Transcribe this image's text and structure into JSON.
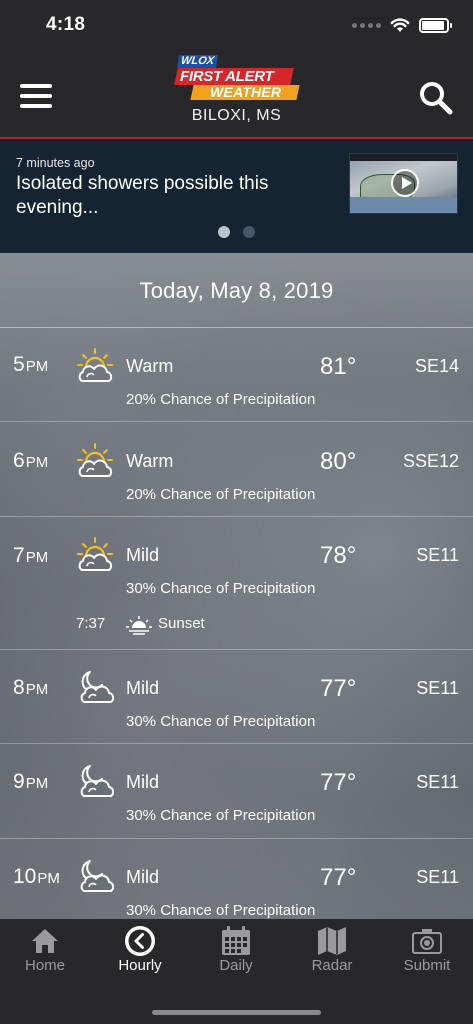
{
  "status_bar": {
    "time": "4:18"
  },
  "header": {
    "logo": {
      "station": "WLOX",
      "line1": "FIRST ALERT",
      "line2": "WEATHER"
    },
    "location": "BILOXI, MS"
  },
  "alert": {
    "timestamp": "7 minutes ago",
    "title": "Isolated showers possible this evening...",
    "pages": 2,
    "active_page": 1
  },
  "forecast": {
    "date": "Today, May 8, 2019",
    "hours": [
      {
        "hour": "5",
        "ampm": "PM",
        "icon": "partly-sunny-icon",
        "desc": "Warm",
        "temp": "81°",
        "wind": "SE14",
        "precip": "20% Chance of Precipitation"
      },
      {
        "hour": "6",
        "ampm": "PM",
        "icon": "partly-sunny-icon",
        "desc": "Warm",
        "temp": "80°",
        "wind": "SSE12",
        "precip": "20% Chance of Precipitation"
      },
      {
        "hour": "7",
        "ampm": "PM",
        "icon": "partly-sunny-icon",
        "desc": "Mild",
        "temp": "78°",
        "wind": "SE11",
        "precip": "30% Chance of Precipitation",
        "sunset": {
          "time": "7:37",
          "label": "Sunset"
        }
      },
      {
        "hour": "8",
        "ampm": "PM",
        "icon": "partly-cloudy-night-icon",
        "desc": "Mild",
        "temp": "77°",
        "wind": "SE11",
        "precip": "30% Chance of Precipitation"
      },
      {
        "hour": "9",
        "ampm": "PM",
        "icon": "partly-cloudy-night-icon",
        "desc": "Mild",
        "temp": "77°",
        "wind": "SE11",
        "precip": "30% Chance of Precipitation"
      },
      {
        "hour": "10",
        "ampm": "PM",
        "icon": "partly-cloudy-night-icon",
        "desc": "Mild",
        "temp": "77°",
        "wind": "SE11",
        "precip": "30% Chance of Precipitation"
      }
    ]
  },
  "tabbar": {
    "items": [
      {
        "label": "Home",
        "icon": "home-icon"
      },
      {
        "label": "Hourly",
        "icon": "clock-icon"
      },
      {
        "label": "Daily",
        "icon": "calendar-icon"
      },
      {
        "label": "Radar",
        "icon": "map-icon"
      },
      {
        "label": "Submit",
        "icon": "camera-icon"
      }
    ],
    "active": "Hourly"
  }
}
